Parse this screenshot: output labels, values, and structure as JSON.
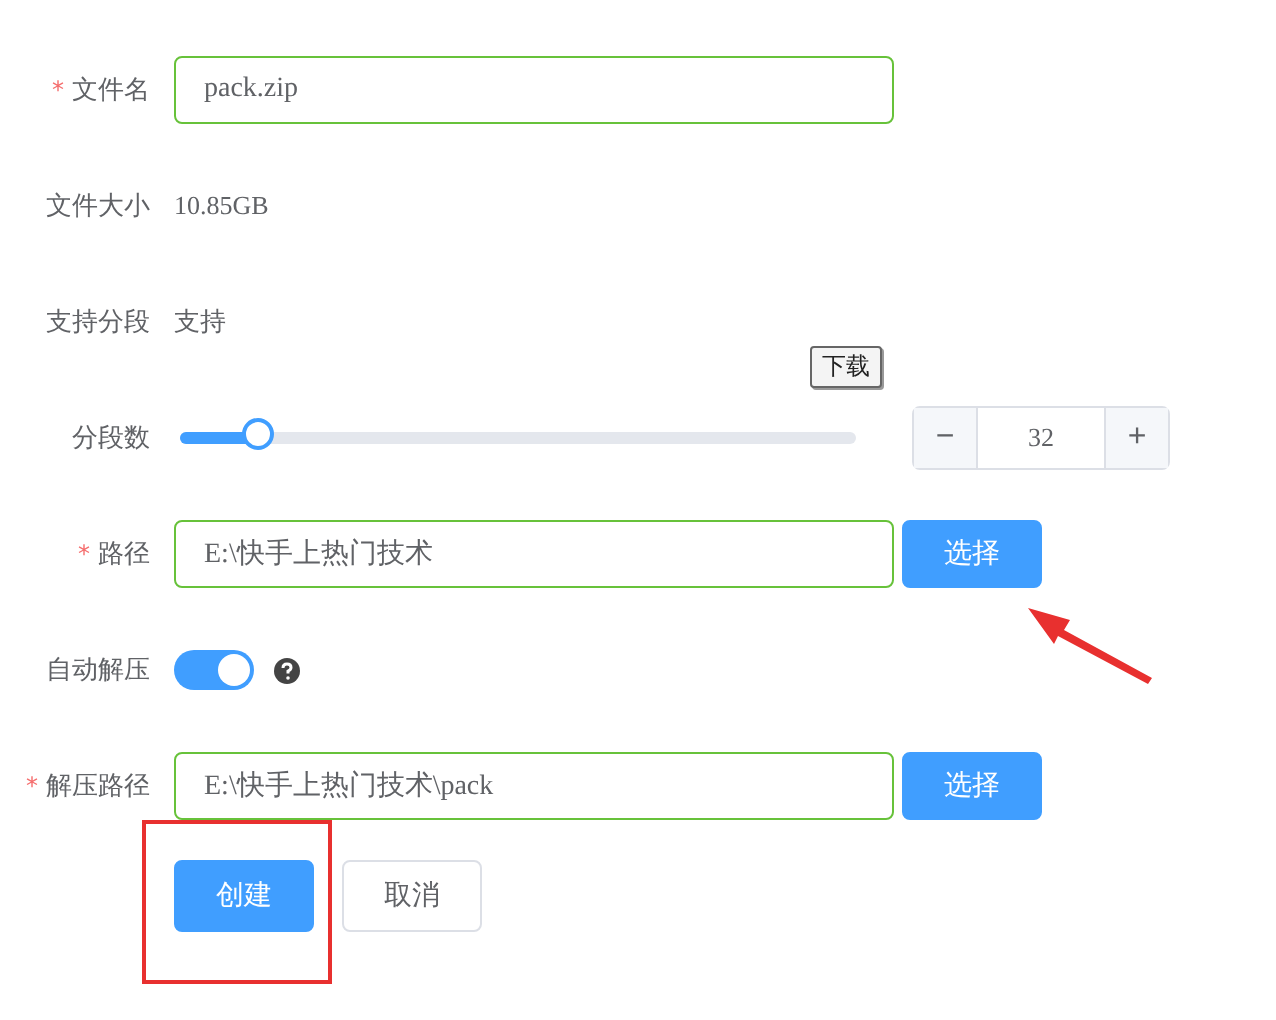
{
  "fields": [
    {
      "kind": "input",
      "label": "文件名",
      "required_mark": "*",
      "value": "pack.zip"
    },
    {
      "kind": "text",
      "label": "文件大小",
      "value": "10.85GB"
    },
    {
      "kind": "text",
      "label": "支持分段",
      "value": "支持"
    },
    {
      "kind": "slider",
      "label": "分段数",
      "level": 0.12,
      "tooltip": "下载",
      "decrement": "−",
      "value": "32",
      "increment": "+"
    },
    {
      "kind": "path",
      "label": "路径",
      "required_mark": "*",
      "value": "E:\\快手上热门技术",
      "button": "选择"
    },
    {
      "kind": "switch",
      "label": "自动解压",
      "on": true
    },
    {
      "kind": "path",
      "label": "解压路径",
      "required_mark": "*",
      "value": "E:\\快手上热门技术\\pack",
      "button": "选择"
    }
  ],
  "actions": [
    {
      "label": "创建",
      "primary": true
    },
    {
      "label": "取消",
      "primary": false
    }
  ]
}
